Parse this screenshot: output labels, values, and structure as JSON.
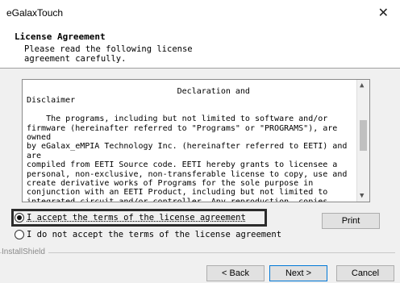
{
  "window": {
    "title": "eGalaxTouch",
    "close_glyph": "✕"
  },
  "header": {
    "title": "License Agreement",
    "subtitle": "Please read the following license agreement carefully."
  },
  "license": {
    "text": "                               Declaration and\nDisclaimer\n\n    The programs, including but not limited to software and/or\nfirmware (hereinafter referred to \"Programs\" or \"PROGRAMS\"), are owned\nby eGalax_eMPIA Technology Inc. (hereinafter referred to EETI) and are\ncompiled from EETI Source code. EETI hereby grants to licensee a\npersonal, non-exclusive, non-transferable license to copy, use and\ncreate derivative works of Programs for the sole purpose in\nconjunction with an EETI Product, including but not limited to\nintegrated circuit and/or controller. Any reproduction, copies,\nmodification, translation, compilation, application, or representation"
  },
  "options": {
    "accept": "I accept the terms of the license agreement",
    "decline": "I do not accept the terms of the license agreement",
    "selected": "accept"
  },
  "footer": {
    "brand": "InstallShield"
  },
  "buttons": {
    "print": "Print",
    "back": "< Back",
    "next": "Next >",
    "cancel": "Cancel"
  }
}
